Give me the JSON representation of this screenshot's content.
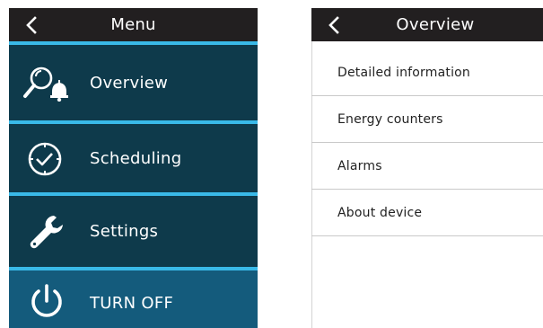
{
  "menu_screen": {
    "title": "Menu",
    "items": [
      {
        "label": "Overview",
        "icon": "search-bell-icon"
      },
      {
        "label": "Scheduling",
        "icon": "clock-icon"
      },
      {
        "label": "Settings",
        "icon": "wrench-icon"
      },
      {
        "label": "TURN OFF",
        "icon": "power-icon"
      }
    ]
  },
  "overview_screen": {
    "title": "Overview",
    "items": [
      {
        "label": "Detailed information"
      },
      {
        "label": "Energy counters"
      },
      {
        "label": "Alarms"
      },
      {
        "label": "About device"
      }
    ]
  },
  "colors": {
    "header_bg": "#221f20",
    "separator": "#39b9e8",
    "menu_item_bg": "#0e3a4b",
    "turn_off_bg": "#145b7c",
    "list_divider": "#c9c9c9"
  }
}
